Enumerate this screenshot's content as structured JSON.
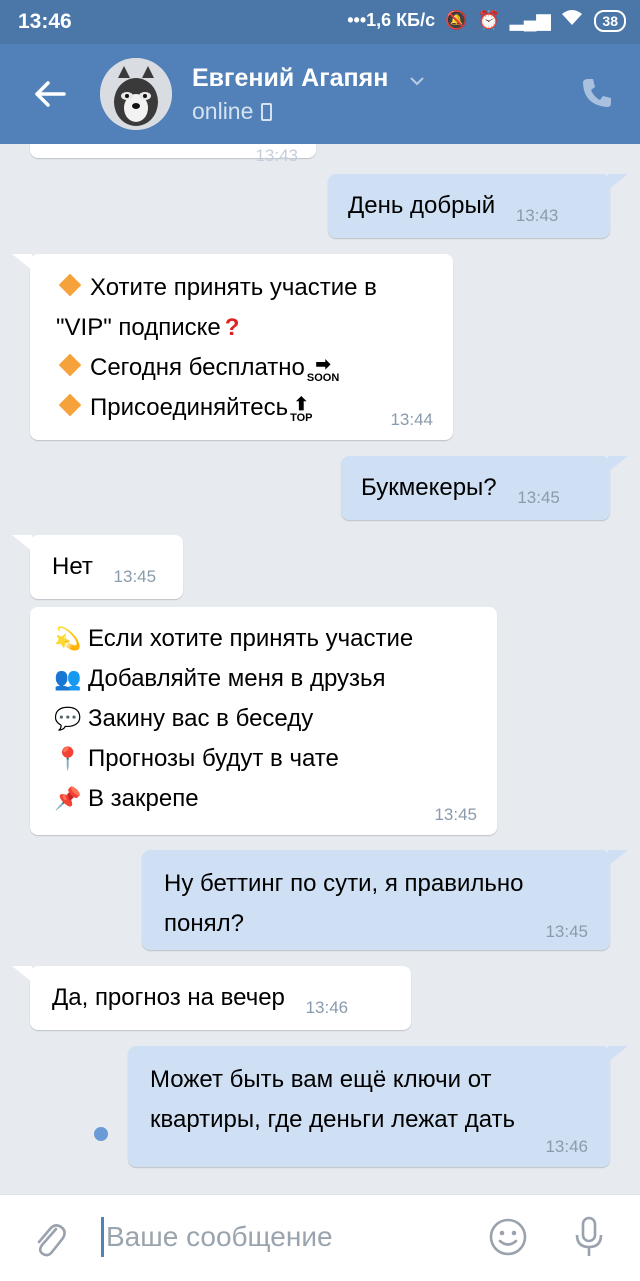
{
  "status_bar": {
    "time": "13:46",
    "network_speed": "1,6 КБ/с",
    "battery": "38"
  },
  "header": {
    "contact_name": "Евгений Агапян",
    "presence": "online"
  },
  "messages": [
    {
      "direction": "in",
      "time": "13:43",
      "partial": true
    },
    {
      "direction": "out",
      "text": "День добрый",
      "time": "13:43"
    },
    {
      "direction": "in",
      "lines": [
        "Хотите принять участие в",
        "\"VIP\" подписке",
        "Сегодня бесплатно",
        "Присоединяйтесь"
      ],
      "badges": [
        "SOON",
        "TOP"
      ],
      "time": "13:44"
    },
    {
      "direction": "out",
      "text": "Букмекеры?",
      "time": "13:45"
    },
    {
      "direction": "in",
      "text": "Нет",
      "time": "13:45"
    },
    {
      "direction": "in",
      "lines": [
        "Если хотите принять участие",
        "Добавляйте меня в друзья",
        "Закину вас в беседу",
        "Прогнозы будут в чате",
        "В закрепе"
      ],
      "time": "13:45"
    },
    {
      "direction": "out",
      "lines": [
        "Ну беттинг по сути, я правильно",
        "понял?"
      ],
      "time": "13:45"
    },
    {
      "direction": "in",
      "text": "Да, прогноз на вечер",
      "time": "13:46"
    },
    {
      "direction": "out",
      "lines": [
        "Может быть вам ещё ключи от",
        "квартиры, где деньги лежат дать"
      ],
      "time": "13:46"
    }
  ],
  "composer": {
    "placeholder": "Ваше сообщение"
  },
  "colors": {
    "header": "#5181b8",
    "status_bar": "#4a76a8",
    "chat_background": "#e7ebf0",
    "incoming_bubble": "#ffffff",
    "outgoing_bubble": "#cfe0f4"
  }
}
